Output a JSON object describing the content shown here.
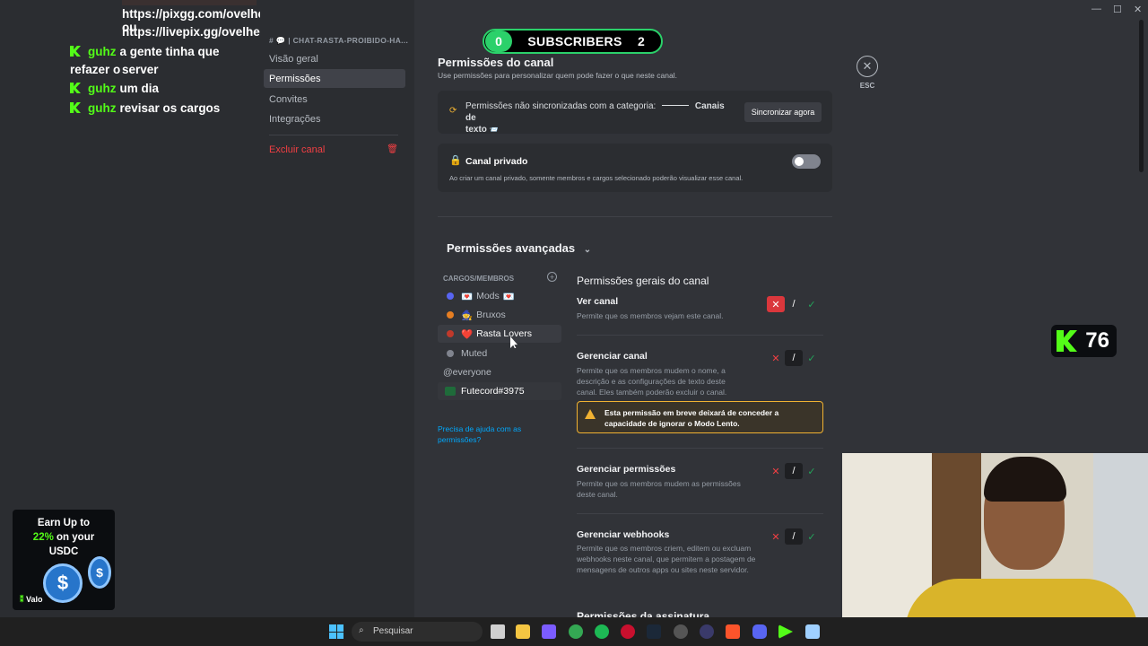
{
  "chat": {
    "top1": "https://pixgg.com/ovelhera ou",
    "top2": "https://livepix.gg/ovelhera",
    "lines": [
      {
        "user": "guhz",
        "text": "a gente tinha que refazer o"
      },
      {
        "user": "",
        "text": "server"
      },
      {
        "user": "guhz",
        "text": "um dia"
      },
      {
        "user": "guhz",
        "text": "revisar os cargos"
      }
    ]
  },
  "promo": {
    "line1": "Earn Up to",
    "pct": "22%",
    "line2": "on your",
    "line3": "USDC",
    "brand": "Valo"
  },
  "sidebar": {
    "header": "CHAT-RASTA-PROIBIDO-HA...",
    "items": [
      "Visão geral",
      "Permissões",
      "Convites",
      "Integrações"
    ],
    "delete": "Excluir canal"
  },
  "subs": {
    "left": "0",
    "label": "SUBSCRIBERS",
    "right": "2"
  },
  "page": {
    "title": "Permissões do canal",
    "subtitle": "Use permissões para personalizar quem pode fazer o que neste canal.",
    "sync_text": "Permissões não sincronizadas com a categoria:",
    "sync_cat": "Canais de",
    "sync_cat2": "texto",
    "sync_btn": "Sincronizar agora",
    "private_title": "Canal privado",
    "private_desc": "Ao criar um canal privado, somente membros e cargos selecionado poderão visualizar esse canal.",
    "advanced": "Permissões avançadas",
    "roles_header": "CARGOS/MEMBROS",
    "help": "Precisa de ajuda com as permissões?",
    "general_title": "Permissões gerais do canal",
    "next_section": "Permissões da assinatura"
  },
  "roles": [
    {
      "name": "Mods",
      "color": "#5865f2",
      "emoji": "💌"
    },
    {
      "name": "Bruxos",
      "color": "#e67e22",
      "emoji": "🧙"
    },
    {
      "name": "Rasta Lovers",
      "color": "#c0392b",
      "emoji": "❤️"
    },
    {
      "name": "Muted",
      "color": "#80848e",
      "emoji": ""
    },
    {
      "name": "@everyone",
      "color": "",
      "emoji": ""
    },
    {
      "name": "Futecord#3975",
      "color": "",
      "emoji": ""
    }
  ],
  "perms": [
    {
      "title": "Ver canal",
      "desc": "Permite que os membros vejam este canal."
    },
    {
      "title": "Gerenciar canal",
      "desc": "Permite que os membros mudem o nome, a descrição e as configurações de texto deste canal. Eles também poderão excluir o canal."
    },
    {
      "title": "Gerenciar permissões",
      "desc": "Permite que os membros mudem as permissões deste canal."
    },
    {
      "title": "Gerenciar webhooks",
      "desc": "Permite que os membros criem, editem ou excluam webhooks neste canal, que permitem a postagem de mensagens de outros apps ou sites neste servidor."
    }
  ],
  "warning": "Esta permissão em breve deixará de conceder a capacidade de ignorar o Modo Lento.",
  "esc": "ESC",
  "kick_count": "76",
  "taskbar": {
    "search": "Pesquisar"
  },
  "colors": {
    "accent": "#5865f2",
    "danger": "#f23f43",
    "success": "#23a55a",
    "kick": "#53fc18"
  }
}
